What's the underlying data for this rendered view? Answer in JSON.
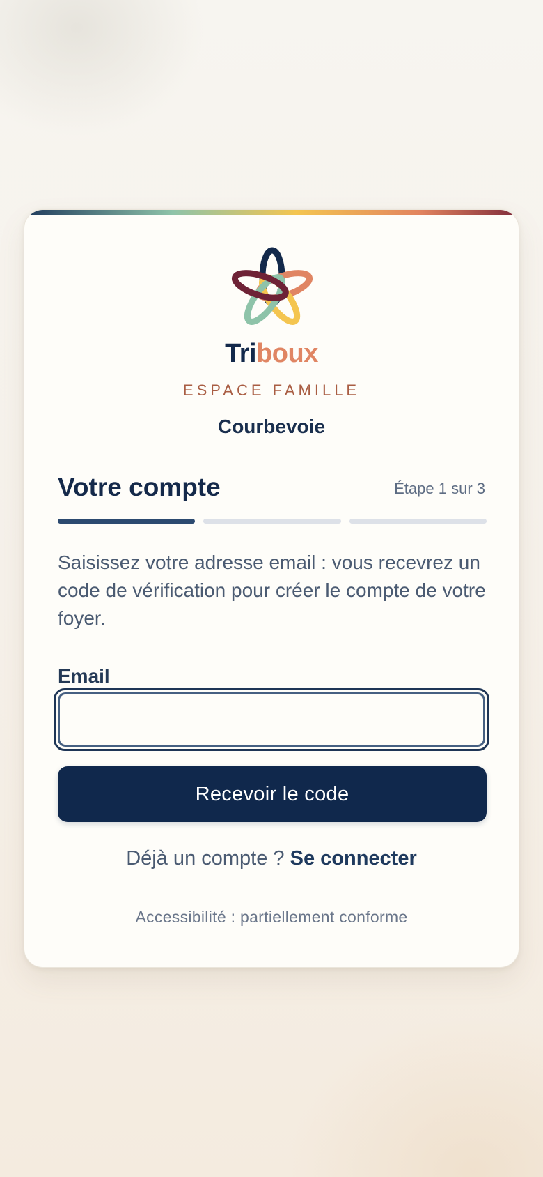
{
  "brand": {
    "name_part1": "Tri",
    "name_part2": "boux",
    "subtitle": "ESPACE FAMILLE",
    "city": "Courbevoie",
    "logo_icon": "five-ring-star-logo-icon",
    "colors": {
      "navy": "#13294b",
      "coral": "#e08563",
      "terracotta": "#a95d43",
      "sage": "#8ec3a9",
      "mustard": "#f4c550",
      "burgundy": "#6e2236"
    }
  },
  "form": {
    "section_title": "Votre compte",
    "step_label": "Étape 1 sur 3",
    "step_current": 1,
    "step_total": 3,
    "intro": "Saisissez votre adresse email : vous recevrez un code de vérification pour créer le compte de votre foyer.",
    "email_label": "Email",
    "email_value": "",
    "submit_label": "Recevoir le code"
  },
  "footer": {
    "has_account_text": "Déjà un compte ?",
    "signin_label": "Se connecter",
    "accessibility": "Accessibilité : partiellement conforme"
  }
}
